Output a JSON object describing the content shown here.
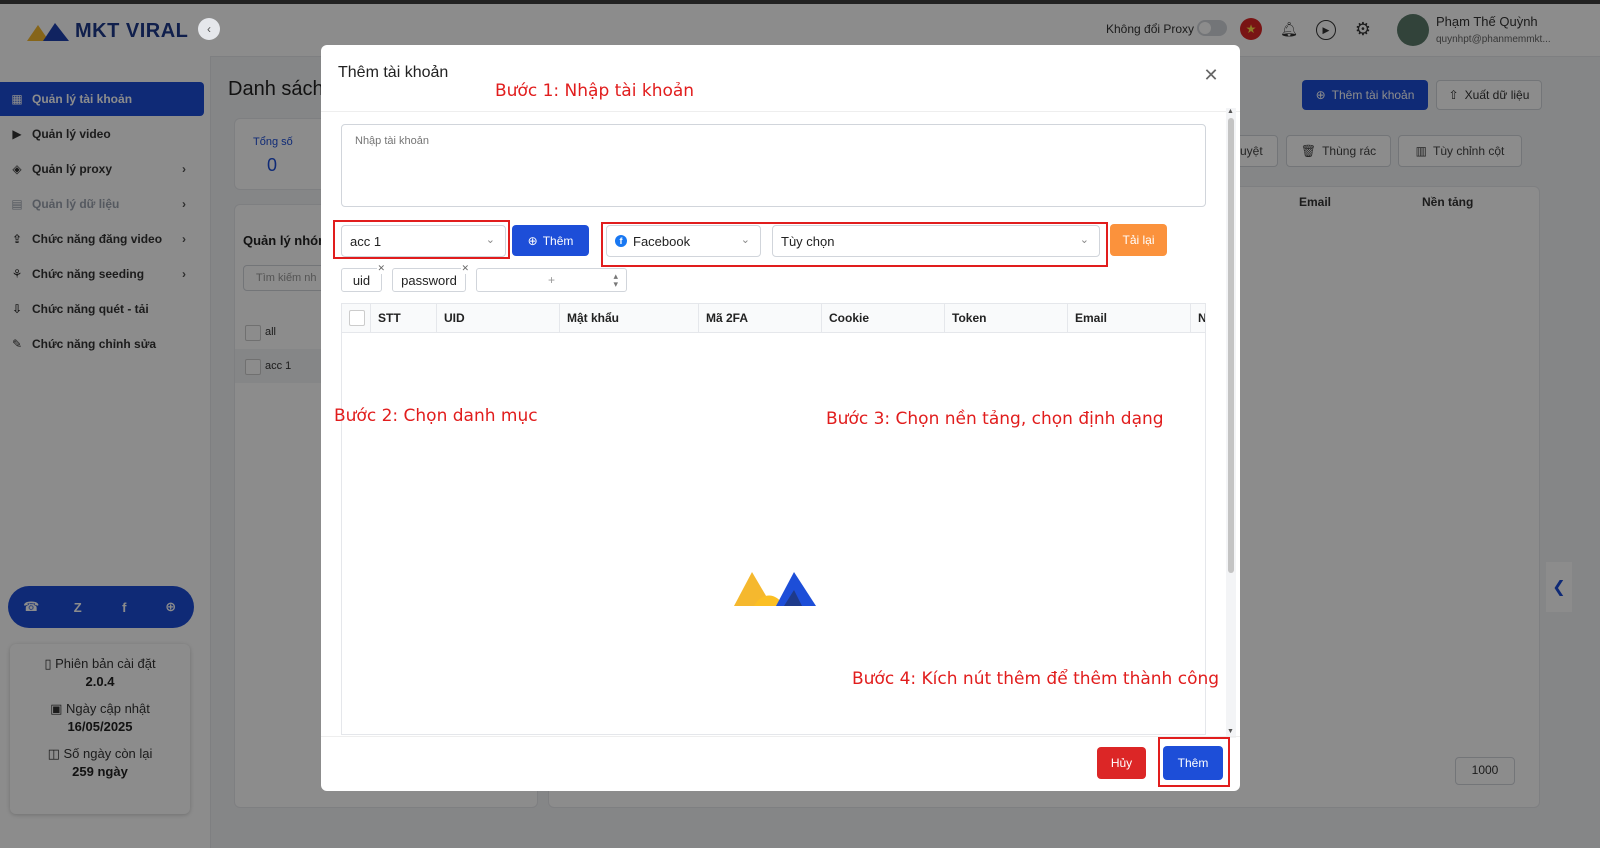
{
  "app": {
    "logo_text": "MKT VIRAL",
    "accent": "#1d4ed8"
  },
  "sidebar": {
    "items": [
      {
        "label": "Quản lý tài khoản",
        "icon": "grid-icon",
        "active": true
      },
      {
        "label": "Quản lý video",
        "icon": "video-icon"
      },
      {
        "label": "Quản lý proxy",
        "icon": "layers-icon"
      },
      {
        "label": "Quản lý dữ liệu",
        "icon": "database-icon",
        "disabled": true
      },
      {
        "label": "Chức năng đăng video",
        "icon": "upload-icon"
      },
      {
        "label": "Chức năng seeding",
        "icon": "seeding-icon"
      },
      {
        "label": "Chức năng quét - tải",
        "icon": "download-icon"
      },
      {
        "label": "Chức năng chỉnh sửa",
        "icon": "edit-icon"
      }
    ],
    "info": {
      "version_label": "Phiên bản cài đặt",
      "version_value": "2.0.4",
      "update_label": "Ngày cập nhật",
      "update_value": "16/05/2025",
      "days_label": "Số ngày còn lại",
      "days_value": "259 ngày"
    }
  },
  "header": {
    "proxy_label": "Không đổi Proxy",
    "user_name": "Phạm Thế Quỳnh",
    "user_email": "quynhpt@phanmemmkt..."
  },
  "main": {
    "page_title": "Danh sách",
    "add_account_label": "Thêm tài khoản",
    "export_label": "Xuất dữ liệu",
    "stat_label": "Tổng số",
    "stat_value": "0",
    "toolbar": {
      "approve": "duyệt",
      "trash": "Thùng rác",
      "columns": "Tùy chỉnh cột"
    },
    "table_headers": {
      "email": "Email",
      "platform": "Nền tảng"
    },
    "group_title": "Quản lý nhón",
    "group_search_placeholder": "Tìm kiếm nh",
    "groups": [
      "all",
      "acc 1"
    ],
    "page_size": "1000"
  },
  "modal": {
    "title": "Thêm tài khoản",
    "textarea_placeholder": "Nhập tài khoản",
    "category_value": "acc 1",
    "add_button": "Thêm",
    "platform_value": "Facebook",
    "format_value": "Tùy chọn",
    "reload_button": "Tải lại",
    "tags": [
      "uid",
      "password"
    ],
    "stepper_placeholder": "+",
    "columns": [
      "STT",
      "UID",
      "Mật khẩu",
      "Mã 2FA",
      "Cookie",
      "Token",
      "Email",
      "N"
    ],
    "cancel_button": "Hủy",
    "submit_button": "Thêm"
  },
  "annotations": {
    "step1": "Bước 1: Nhập tài khoản",
    "step2": "Bước 2: Chọn danh mục",
    "step3": "Bước 3: Chọn nền tảng, chọn định dạng",
    "step4": "Bước 4: Kích nút thêm để thêm thành công",
    "color": "#e11d1d"
  }
}
